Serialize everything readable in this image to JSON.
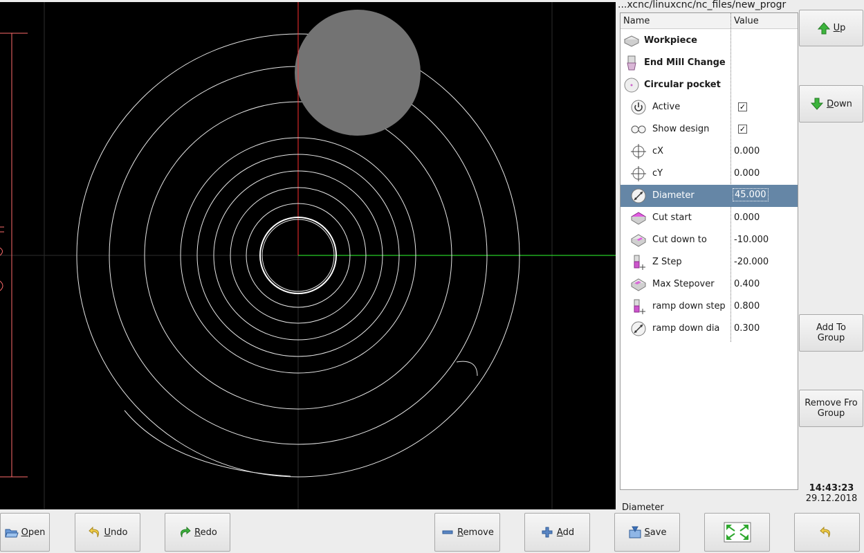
{
  "path_title": "...xcnc/linuxcnc/nc_files/new_progr",
  "tree": {
    "columns": [
      "Name",
      "Value"
    ],
    "rows": [
      {
        "label": "Workpiece",
        "value": "",
        "bold": true,
        "icon": "workpiece-icon"
      },
      {
        "label": "End Mill Change",
        "value": "",
        "bold": true,
        "icon": "end-mill-icon"
      },
      {
        "label": "Circular pocket",
        "value": "",
        "bold": true,
        "icon": "circular-pocket-icon"
      },
      {
        "label": "Active",
        "value": "",
        "checked": true,
        "icon": "power-icon"
      },
      {
        "label": "Show design",
        "value": "",
        "checked": true,
        "icon": "glasses-icon"
      },
      {
        "label": "cX",
        "value": "0.000",
        "icon": "crosshair-icon"
      },
      {
        "label": "cY",
        "value": "0.000",
        "icon": "crosshair-icon"
      },
      {
        "label": "Diameter",
        "value": "45.000",
        "selected": true,
        "icon": "diameter-icon"
      },
      {
        "label": "Cut start",
        "value": "0.000",
        "icon": "cut-start-icon"
      },
      {
        "label": "Cut down to",
        "value": "-10.000",
        "icon": "cut-down-icon"
      },
      {
        "label": "Z Step",
        "value": "-20.000",
        "icon": "z-step-icon"
      },
      {
        "label": "Max Stepover",
        "value": "0.400",
        "icon": "stepover-icon"
      },
      {
        "label": "ramp down step",
        "value": "0.800",
        "icon": "z-step-icon"
      },
      {
        "label": "ramp down dia",
        "value": "0.300",
        "icon": "diameter-icon"
      }
    ]
  },
  "status_text": "Diameter",
  "side_buttons": {
    "up": "Up",
    "down": "Down",
    "add_to_group": [
      "Add To",
      "Group"
    ],
    "remove_from_group": [
      "Remove Fro",
      "Group"
    ]
  },
  "clock": {
    "time": "14:43:23",
    "date": "29.12.2018"
  },
  "bottom_buttons": {
    "open": "Open",
    "undo": "Undo",
    "redo": "Redo",
    "remove": "Remove",
    "add": "Add",
    "save": "Save"
  },
  "colors": {
    "selection": "#6586a6",
    "x_axis": "#ff3030",
    "y_axis": "#30ff30",
    "toolpath": "#ffffff",
    "tool": "#737373",
    "dimension": "#ff6b6b",
    "up_arrow": "#3cb43c",
    "down_arrow": "#3cb43c"
  }
}
